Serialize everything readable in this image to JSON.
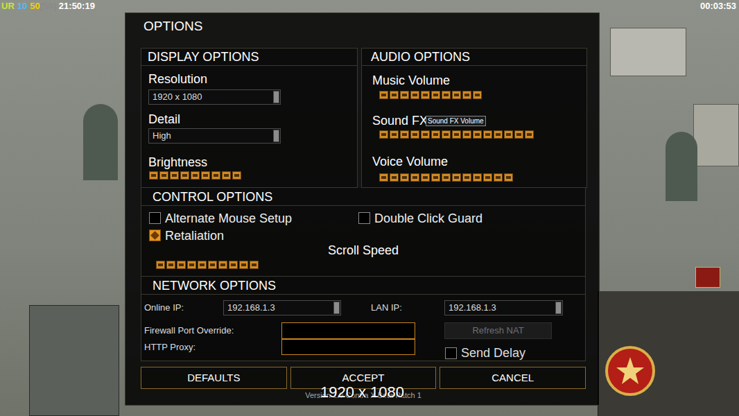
{
  "hud": {
    "mode": "UR",
    "count": "10",
    "power": "50",
    "power_max": "[50]",
    "clock": "21:50:19",
    "timer": "00:03:53"
  },
  "dialog": {
    "title": "OPTIONS"
  },
  "display": {
    "header": "DISPLAY OPTIONS",
    "resolution": {
      "label": "Resolution",
      "value": "1920 x 1080"
    },
    "detail": {
      "label": "Detail",
      "value": "High"
    },
    "brightness": {
      "label": "Brightness",
      "level": 0.5
    }
  },
  "audio": {
    "header": "AUDIO OPTIONS",
    "sliders": [
      {
        "label": "Music Volume",
        "level": 0.5
      },
      {
        "label": "Sound FX Volume",
        "level": 0.75
      },
      {
        "label": "Voice Volume",
        "level": 0.65
      }
    ],
    "tooltip": "Sound FX Volume"
  },
  "controls": {
    "header": "CONTROL OPTIONS",
    "checkboxes": [
      {
        "label": "Alternate Mouse Setup",
        "checked": false
      },
      {
        "label": "Double Click Guard",
        "checked": false
      },
      {
        "label": "Retaliation",
        "checked": true
      }
    ],
    "scroll": {
      "label": "Scroll Speed",
      "level": 0.5
    }
  },
  "network": {
    "header": "NETWORK OPTIONS",
    "online_ip": {
      "label": "Online IP:",
      "value": "192.168.1.3"
    },
    "lan_ip": {
      "label": "LAN IP:",
      "value": "192.168.1.3"
    },
    "firewall": {
      "label": "Firewall Port Override:",
      "value": ""
    },
    "proxy": {
      "label": "HTTP Proxy:",
      "value": ""
    },
    "refresh": {
      "label": "Refresh NAT",
      "disabled": true
    },
    "send_delay": {
      "label": "Send Delay",
      "checked": false
    }
  },
  "buttons": [
    {
      "label": "DEFAULTS"
    },
    {
      "label": "ACCEPT"
    },
    {
      "label": "CANCEL"
    }
  ],
  "version": "Version 1.9 Contra X Beta Patch 1",
  "overlay": "1920 x 1080"
}
